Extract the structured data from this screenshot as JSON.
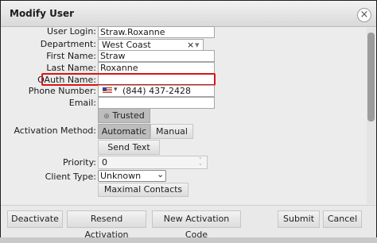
{
  "dialog": {
    "title": "Modify User",
    "close_glyph": "×"
  },
  "form": {
    "user_login": {
      "label": "User Login:",
      "value": "Straw.Roxanne"
    },
    "department": {
      "label": "Department:",
      "value": "West Coast",
      "clear_glyph": "×",
      "arrow_glyph": "▾"
    },
    "first_name": {
      "label": "First Name:",
      "value": "Straw"
    },
    "last_name": {
      "label": "Last Name:",
      "value": "Roxanne"
    },
    "oauth_name": {
      "label": "OAuth Name:",
      "value": ""
    },
    "phone_number": {
      "label": "Phone Number:",
      "value": "(844) 437-2428",
      "country_arrow": "▾"
    },
    "email": {
      "label": "Email:",
      "value": ""
    },
    "activation_method": {
      "label": "Activation Method:",
      "trusted_label": "Trusted",
      "trusted_icon": "⊛",
      "automatic_label": "Automatic",
      "manual_label": "Manual",
      "send_text_label": "Send Text"
    },
    "priority": {
      "label": "Priority:",
      "value": "0"
    },
    "client_type": {
      "label": "Client Type:",
      "value": "Unknown",
      "arrow_glyph": "⌄"
    },
    "maximal_contacts_label": "Maximal Contacts"
  },
  "footer": {
    "deactivate": "Deactivate",
    "resend_activation": "Resend Activation",
    "new_activation_code": "New Activation Code",
    "submit": "Submit",
    "cancel": "Cancel"
  }
}
